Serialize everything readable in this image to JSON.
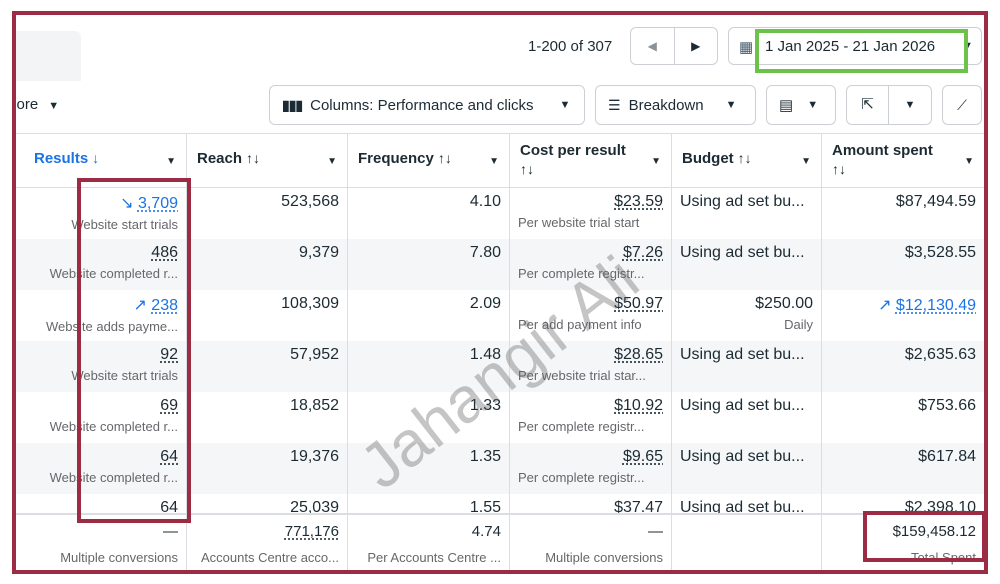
{
  "pager": {
    "range_text": "1-200 of 307",
    "prev_icon": "chevron-left-icon",
    "next_icon": "chevron-right-icon"
  },
  "date_range": {
    "label": "1 Jan 2025 - 21 Jan 2026",
    "icon": "calendar-icon"
  },
  "toolbar": {
    "more_label": "More",
    "columns_label": "Columns: Performance and clicks",
    "breakdown_label": "Breakdown"
  },
  "table": {
    "headers": [
      {
        "label": "Results",
        "sort": "↓"
      },
      {
        "label": "Reach",
        "sort": "↑↓"
      },
      {
        "label": "Frequency",
        "sort": "↑↓"
      },
      {
        "label": "Cost per result",
        "sort": "↑↓"
      },
      {
        "label": "Budget",
        "sort": "↑↓"
      },
      {
        "label": "Amount spent",
        "sort": "↑↓"
      }
    ],
    "rows": [
      {
        "results": "3,709",
        "results_sub": "Website start trials",
        "trend": "↘",
        "reach": "523,568",
        "frequency": "4.10",
        "cost": "$23.59",
        "cost_sub": "Per website trial start",
        "budget": "Using ad set bu...",
        "budget_sub": "",
        "spent": "$87,494.59"
      },
      {
        "results": "486",
        "results_sub": "Website completed r...",
        "trend": "",
        "reach": "9,379",
        "frequency": "7.80",
        "cost": "$7.26",
        "cost_sub": "Per complete registr...",
        "budget": "Using ad set bu...",
        "budget_sub": "",
        "spent": "$3,528.55"
      },
      {
        "results": "238",
        "results_sub": "Website adds payme...",
        "trend": "↗",
        "reach": "108,309",
        "frequency": "2.09",
        "cost": "$50.97",
        "cost_sub": "Per add payment info",
        "budget": "$250.00",
        "budget_sub": "Daily",
        "spent": "$12,130.49",
        "spent_trend": "↗"
      },
      {
        "results": "92",
        "results_sub": "Website start trials",
        "trend": "",
        "reach": "57,952",
        "frequency": "1.48",
        "cost": "$28.65",
        "cost_sub": "Per website trial star...",
        "budget": "Using ad set bu...",
        "budget_sub": "",
        "spent": "$2,635.63"
      },
      {
        "results": "69",
        "results_sub": "Website completed r...",
        "trend": "",
        "reach": "18,852",
        "frequency": "1.33",
        "cost": "$10.92",
        "cost_sub": "Per complete registr...",
        "budget": "Using ad set bu...",
        "budget_sub": "",
        "spent": "$753.66"
      },
      {
        "results": "64",
        "results_sub": "Website completed r...",
        "trend": "",
        "reach": "19,376",
        "frequency": "1.35",
        "cost": "$9.65",
        "cost_sub": "Per complete registr...",
        "budget": "Using ad set bu...",
        "budget_sub": "",
        "spent": "$617.84"
      },
      {
        "results": "64",
        "results_sub": "",
        "trend": "",
        "reach": "25,039",
        "frequency": "1.55",
        "cost": "$37.47",
        "cost_sub": "",
        "budget": "Using ad set bu...",
        "budget_sub": "",
        "spent": "$2,398.10"
      }
    ],
    "totals": {
      "results": "—",
      "results_sub": "Multiple conversions",
      "reach": "771,176",
      "reach_sub": "Accounts Centre acco...",
      "frequency": "4.74",
      "frequency_sub": "Per Accounts Centre ...",
      "cost": "—",
      "cost_sub": "Multiple conversions",
      "spent": "$159,458.12",
      "spent_sub": "Total Spent"
    }
  },
  "watermark": "Jahangir Ali",
  "colors": {
    "accent": "#1b74e4",
    "highlight_green": "#6cc24a",
    "highlight_red": "#9b2c43"
  }
}
